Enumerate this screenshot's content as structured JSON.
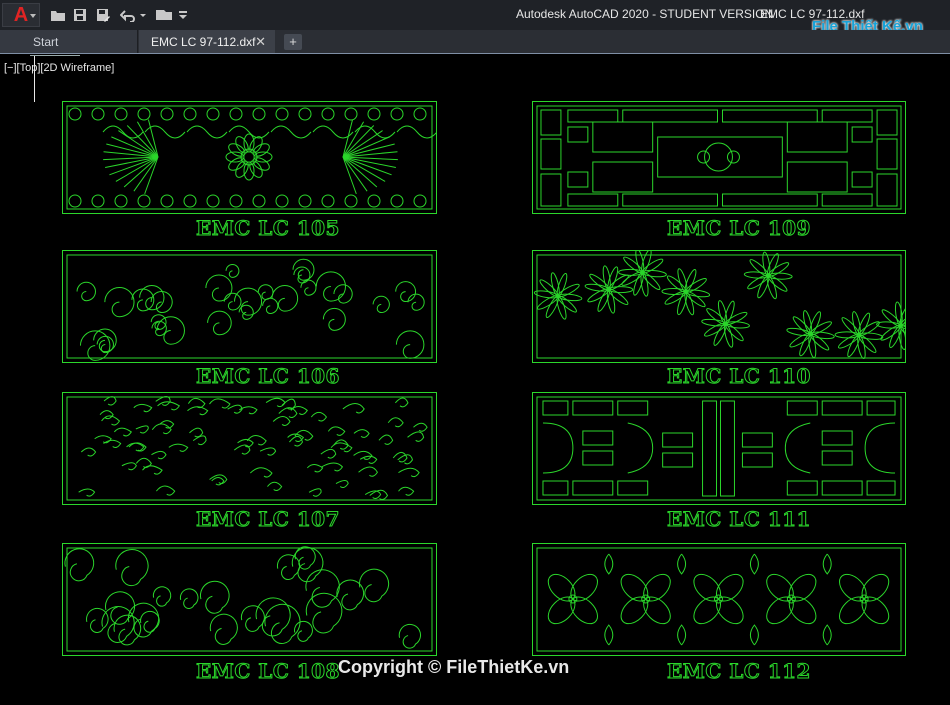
{
  "app": {
    "window_title": "Autodesk AutoCAD 2020 - STUDENT VERSION",
    "file_title": "EMC LC 97-112.dxf",
    "app_letter": "A"
  },
  "tabs": [
    {
      "label": "Start"
    },
    {
      "label": "EMC LC 97-112.dxf",
      "close": "✕"
    },
    {
      "label": "+"
    }
  ],
  "viewport": {
    "label": "[−][Top][2D Wireframe]"
  },
  "drawings": [
    {
      "label": "EMC LC 105",
      "pattern": "ornament"
    },
    {
      "label": "EMC LC 109",
      "pattern": "lattice"
    },
    {
      "label": "EMC LC 106",
      "pattern": "clouds"
    },
    {
      "label": "EMC LC 110",
      "pattern": "flowers"
    },
    {
      "label": "EMC LC 107",
      "pattern": "dense"
    },
    {
      "label": "EMC LC 111",
      "pattern": "lattice2"
    },
    {
      "label": "EMC LC 108",
      "pattern": "swirls"
    },
    {
      "label": "EMC LC 112",
      "pattern": "petals"
    }
  ],
  "watermark": {
    "logo_text": "File Thiết Kế.vn",
    "copyright": "Copyright © FileThietKe.vn"
  },
  "colors": {
    "cad_line": "#2bd62b",
    "background": "#000000",
    "accent_red": "#e02424"
  }
}
